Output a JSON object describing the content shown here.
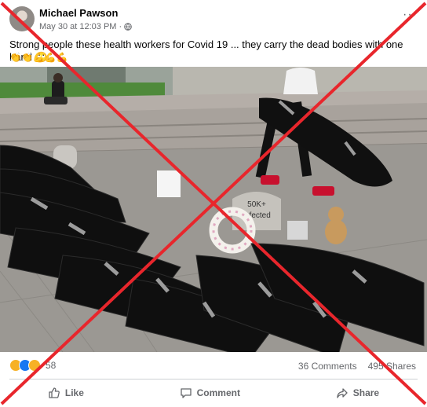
{
  "post": {
    "author": "Michael Pawson",
    "date": "May 30 at 12:03 PM",
    "separator": "·",
    "caption": "Strong people these health workers for Covid 19 ... they carry the dead bodies with one hand",
    "caption_emoji": "🙄",
    "emoji_line": "👏👏💪💪💪",
    "photo_sign_text": [
      "50K+",
      "Infected"
    ],
    "reaction_count": "58",
    "comments": "36 Comments",
    "shares": "495 Shares",
    "actions": {
      "like": "Like",
      "comment": "Comment",
      "share": "Share"
    }
  },
  "icons": [
    "avatar",
    "globe-icon",
    "more-icon",
    "haha-reaction-icon",
    "like-reaction-icon",
    "care-reaction-icon",
    "like-icon",
    "comment-icon",
    "share-icon",
    "red-x-overlay"
  ],
  "colors": {
    "overlay_x": "#e8262c",
    "secondary_text": "#65676b",
    "bag": "#111111"
  }
}
